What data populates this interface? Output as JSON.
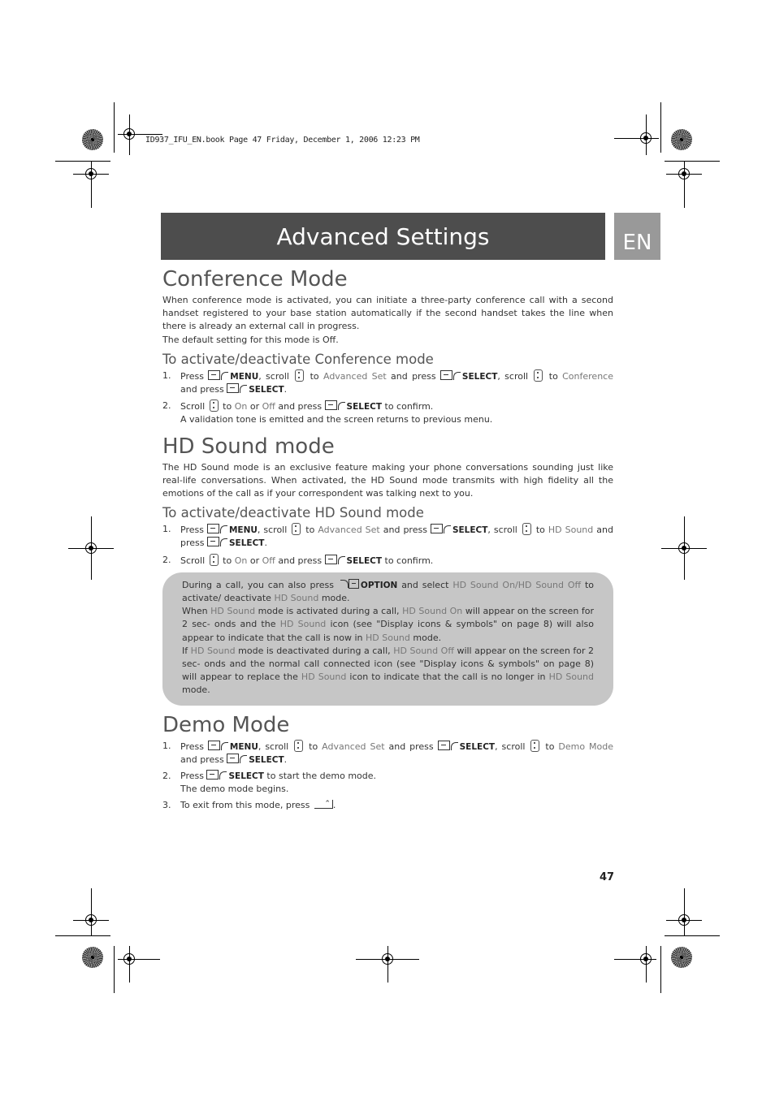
{
  "slug": "ID937_IFU_EN.book  Page 47  Friday, December 1, 2006  12:23 PM",
  "banner": {
    "title": "Advanced Settings",
    "lang": "EN"
  },
  "conference": {
    "title": "Conference Mode",
    "intro": "When conference mode is activated, you can initiate a three-party conference call with a second handset registered to your base station automatically if the second handset takes the line when there is already an external call in progress.",
    "default": "The default setting for this mode is Off.",
    "subtitle": "To activate/deactivate Conference mode",
    "steps": [
      {
        "num": "1.",
        "t1": "Press",
        "menu": "MENU",
        "t2": ", scroll",
        "t3": "to",
        "opt1": "Advanced Set",
        "t4": "and press",
        "select": "SELECT",
        "t5": ", scroll",
        "t6": "to",
        "opt2": "Conference",
        "t7": "and press",
        "select2": "SELECT",
        "t8": "."
      },
      {
        "num": "2.",
        "t1": "Scroll",
        "t2": "to",
        "on": "On",
        "or": "or",
        "off": "Off",
        "t3": "and press",
        "select": "SELECT",
        "t4": "to confirm.",
        "result": "A validation tone is emitted and the screen returns to previous menu."
      }
    ]
  },
  "hdsound": {
    "title": "HD Sound mode",
    "intro": "The HD Sound mode is an exclusive feature making your phone conversations sounding just like real-life conversations. When activated, the HD Sound mode transmits with high fidelity all the emotions of the call as if your correspondent was talking next to you.",
    "subtitle": "To activate/deactivate HD Sound mode",
    "steps": [
      {
        "num": "1.",
        "t1": "Press",
        "menu": "MENU",
        "t2": ", scroll",
        "t3": "to",
        "opt1": "Advanced Set",
        "t4": "and press",
        "select": "SELECT",
        "t5": ", scroll",
        "t6": "to",
        "opt2": "HD Sound",
        "t7": "and press",
        "select2": "SELECT",
        "t8": "."
      },
      {
        "num": "2.",
        "t1": "Scroll",
        "t2": "to",
        "on": "On",
        "or": "or",
        "off": "Off",
        "t3": "and press",
        "select": "SELECT",
        "t4": "to confirm."
      }
    ],
    "note": {
      "p1a": "During a call, you can also press",
      "option": "OPTION",
      "p1b": "and select",
      "p1c": "HD Sound On/HD Sound Off",
      "p1d": "to activate/ deactivate",
      "p1e": "HD Sound",
      "p1f": "mode.",
      "p2a": "When",
      "p2b": "HD Sound",
      "p2c": "mode is activated during a call,",
      "p2d": "HD Sound On",
      "p2e": "will appear on the screen for 2 sec- onds and the",
      "p2f": "HD Sound",
      "p2g": "icon  (see \"Display icons & symbols\" on page 8)  will also appear to indicate that the call is now in",
      "p2h": "HD Sound",
      "p2i": "mode.",
      "p3a": "If",
      "p3b": "HD Sound",
      "p3c": "mode is deactivated during a call,",
      "p3d": "HD Sound Off",
      "p3e": "will appear on the screen for 2 sec- onds and the normal call connected icon (see \"Display icons & symbols\" on page 8) will appear to replace the",
      "p3f": "HD Sound",
      "p3g": "icon to indicate that the call is no longer in",
      "p3h": "HD Sound",
      "p3i": "mode."
    }
  },
  "demo": {
    "title": "Demo Mode",
    "steps": [
      {
        "num": "1.",
        "t1": "Press",
        "menu": "MENU",
        "t2": ", scroll",
        "t3": "to",
        "opt1": "Advanced Set",
        "t4": "and press",
        "select": "SELECT",
        "t5": ", scroll",
        "t6": "to",
        "opt2": "Demo Mode",
        "t7": "and press",
        "select2": "SELECT",
        "t8": "."
      },
      {
        "num": "2.",
        "t1": "Press",
        "select": "SELECT",
        "t2": "to start the demo mode.",
        "result": "The demo mode begins."
      },
      {
        "num": "3.",
        "t1": "To exit from this mode, press",
        "t2": "."
      }
    ]
  },
  "page_number": "47"
}
